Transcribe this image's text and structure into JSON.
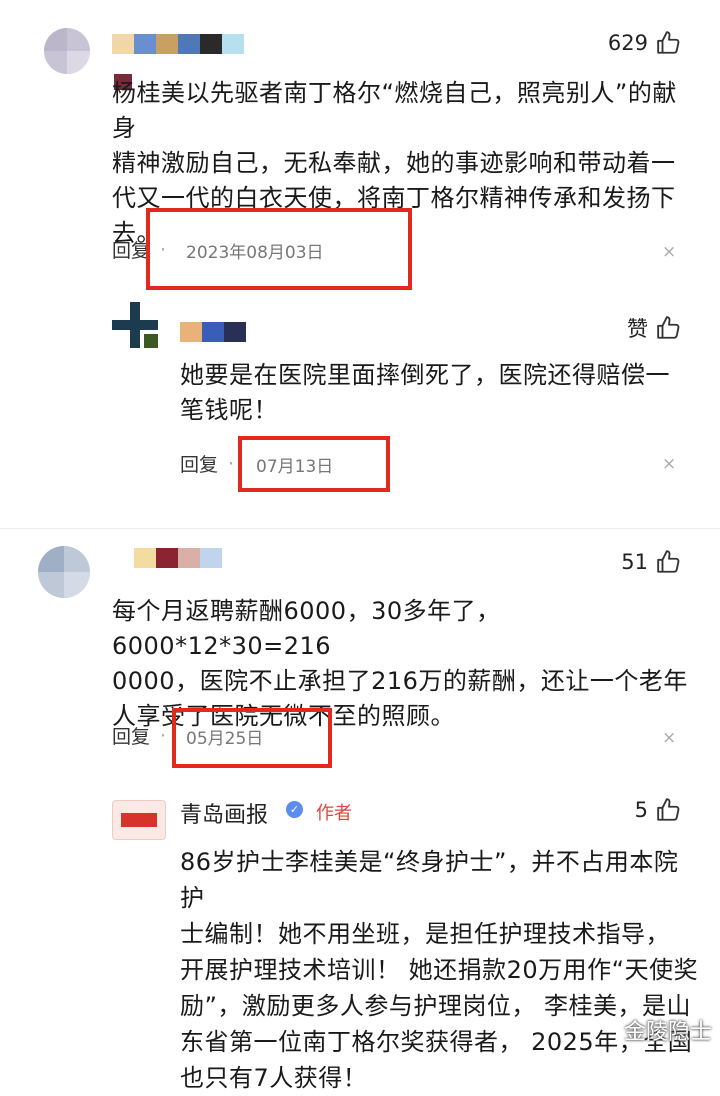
{
  "comments": [
    {
      "likes": "629",
      "lines": [
        "杨桂美以先驱者南丁格尔“燃烧自己，照亮别人”的献身",
        "精神激励自己，无私奉献，她的事迹影响和带动着一",
        "代又一代的白衣天使，将南丁格尔精神传承和发扬下",
        "去。"
      ],
      "reply_label": "回复",
      "date": "2023年08月03日",
      "close": "×"
    },
    {
      "likes": "赞",
      "lines": [
        "她要是在医院里面摔倒死了，医院还得赔偿一",
        "笔钱呢！"
      ],
      "reply_label": "回复",
      "date": "07月13日",
      "close": "×"
    },
    {
      "likes": "51",
      "lines": [
        "每个月返聘薪酬6000，30多年了，6000*12*30=216",
        "0000，医院不止承担了216万的薪酬，还让一个老年",
        "人享受了医院无微不至的照顾。"
      ],
      "reply_label": "回复",
      "date": "05月25日",
      "close": "×"
    },
    {
      "author": "青岛画报",
      "author_tag": "作者",
      "likes": "5",
      "lines": [
        "86岁护士李桂美是“终身护士”，并不占用本院护",
        "士编制！她不用坐班，是担任护理技术指导，",
        "开展护理技术培训！ 她还捐款20万用作“天使奖",
        "励”，激励更多人参与护理岗位， 李桂美，是山",
        "东省第一位南丁格尔奖获得者， 2025年，全国",
        "也只有7人获得！"
      ]
    }
  ],
  "watermark": "金陵隐士",
  "colors": {
    "highlight_box": "#e02a1e",
    "author_tag": "#e0463b",
    "verified": "#5b8def"
  }
}
